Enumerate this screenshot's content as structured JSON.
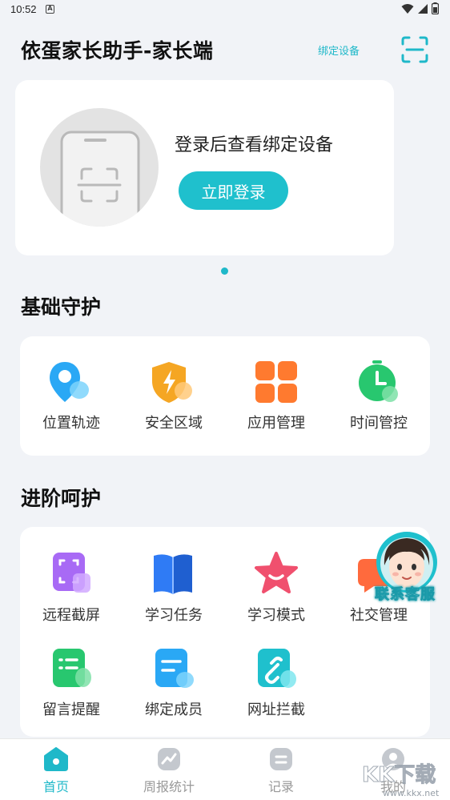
{
  "status_bar": {
    "time": "10:52",
    "notification_letter": "A"
  },
  "header": {
    "title": "依蛋家长助手-家长端",
    "bind_device_link": "绑定设备",
    "scan_icon": "scan-icon"
  },
  "login_card": {
    "prompt": "登录后查看绑定设备",
    "login_button": "立即登录",
    "device_icon": "phone-scan-icon"
  },
  "basic": {
    "title": "基础守护",
    "items": [
      {
        "label": "位置轨迹",
        "icon": "location-pin-icon",
        "color": "#2aa8f5"
      },
      {
        "label": "安全区域",
        "icon": "shield-icon",
        "color": "#f5a623"
      },
      {
        "label": "应用管理",
        "icon": "app-grid-icon",
        "color": "#ff7a2f"
      },
      {
        "label": "时间管控",
        "icon": "alarm-clock-icon",
        "color": "#28c76f"
      }
    ]
  },
  "advanced": {
    "title": "进阶呵护",
    "items": [
      {
        "label": "远程截屏",
        "icon": "screenshot-icon",
        "color": "#a86af5"
      },
      {
        "label": "学习任务",
        "icon": "book-icon",
        "color": "#2f7bf5"
      },
      {
        "label": "学习模式",
        "icon": "star-icon",
        "color": "#f0506e"
      },
      {
        "label": "社交管理",
        "icon": "chat-bubble-icon",
        "color": "#ff6a3d"
      },
      {
        "label": "留言提醒",
        "icon": "message-note-icon",
        "color": "#28c76f"
      },
      {
        "label": "绑定成员",
        "icon": "member-card-icon",
        "color": "#2aa8f5"
      },
      {
        "label": "网址拦截",
        "icon": "link-block-icon",
        "color": "#1fc0cd"
      }
    ]
  },
  "customer_service": {
    "label": "联系客服",
    "icon": "customer-service-avatar-icon"
  },
  "bottom_nav": {
    "items": [
      {
        "label": "首页",
        "icon": "home-icon",
        "active": true
      },
      {
        "label": "周报统计",
        "icon": "chart-icon",
        "active": false
      },
      {
        "label": "记录",
        "icon": "record-icon",
        "active": false
      },
      {
        "label": "我的",
        "icon": "profile-icon",
        "active": false
      }
    ]
  },
  "watermark": {
    "text": "KK下载",
    "url_text": "www.kkx.net"
  },
  "colors": {
    "accent": "#1fb8c9",
    "button": "#1fc0cd",
    "background": "#f1f3f7"
  }
}
